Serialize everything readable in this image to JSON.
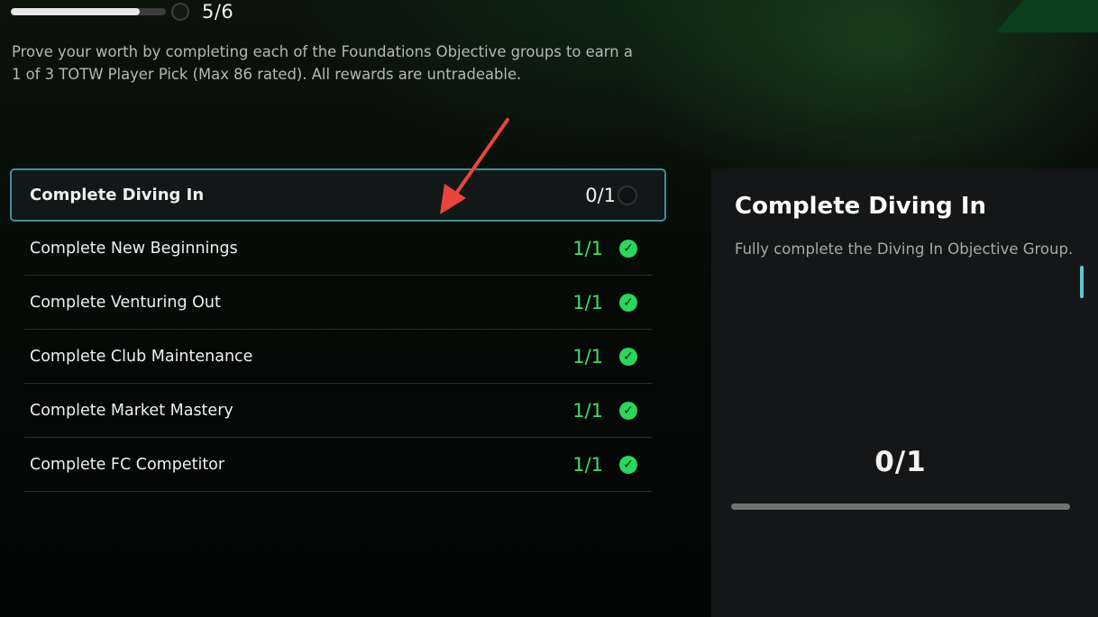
{
  "header": {
    "progress_count": "5/6",
    "progress_fraction": 0.83,
    "description": "Prove your worth by completing each of the Foundations Objective groups to earn a 1 of 3 TOTW Player Pick (Max 86 rated). All rewards are untradeable."
  },
  "objectives": [
    {
      "label": "Complete Diving In",
      "progress": "0/1",
      "completed": false,
      "selected": true
    },
    {
      "label": "Complete New Beginnings",
      "progress": "1/1",
      "completed": true
    },
    {
      "label": "Complete Venturing Out",
      "progress": "1/1",
      "completed": true
    },
    {
      "label": "Complete Club Maintenance",
      "progress": "1/1",
      "completed": true
    },
    {
      "label": "Complete Market Mastery",
      "progress": "1/1",
      "completed": true
    },
    {
      "label": "Complete FC Competitor",
      "progress": "1/1",
      "completed": true
    }
  ],
  "detail": {
    "title": "Complete Diving In",
    "description": "Fully complete the Diving In Objective Group.",
    "progress": "0/1",
    "progress_fraction": 0
  },
  "icons": {
    "check": "check-circle-icon",
    "pending": "empty-circle-icon"
  },
  "colors": {
    "accent_teal": "#3f8f99",
    "complete_green": "#3ddc68",
    "annotation_arrow": "#e8463a"
  }
}
